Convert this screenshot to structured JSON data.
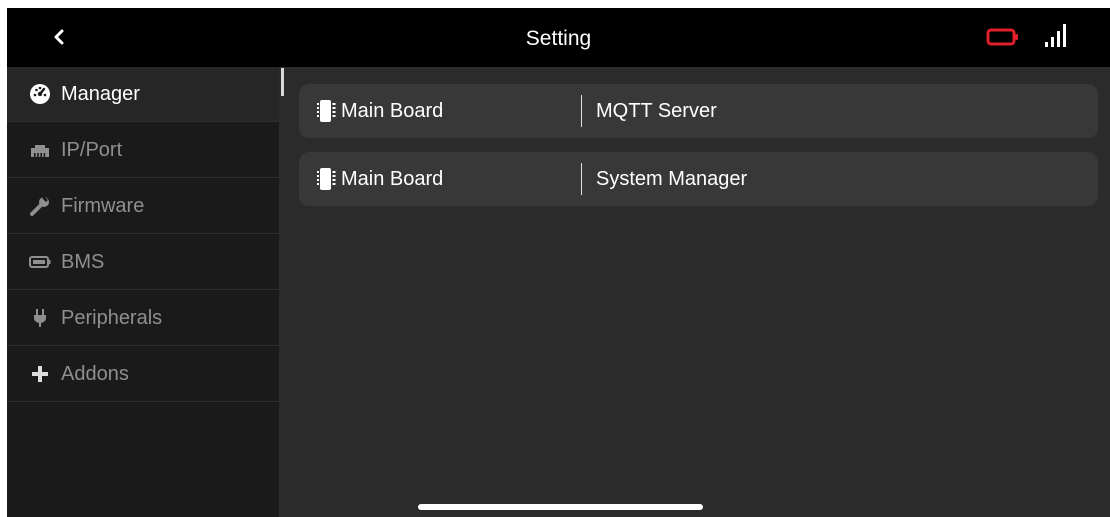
{
  "header": {
    "title": "Setting",
    "back_icon": "chevron-left-icon",
    "battery_icon": "battery-icon",
    "signal_icon": "signal-bars-icon",
    "battery_color": "#e0202a"
  },
  "sidebar": {
    "items": [
      {
        "label": "Manager",
        "icon": "dashboard-gauge-icon",
        "active": true
      },
      {
        "label": "IP/Port",
        "icon": "ethernet-port-icon",
        "active": false
      },
      {
        "label": "Firmware",
        "icon": "wrench-icon",
        "active": false
      },
      {
        "label": "BMS",
        "icon": "battery-icon",
        "active": false
      },
      {
        "label": "Peripherals",
        "icon": "plug-icon",
        "active": false
      },
      {
        "label": "Addons",
        "icon": "plus-icon",
        "active": false
      }
    ]
  },
  "rows": [
    {
      "board": "Main Board",
      "name": "MQTT Server",
      "icon": "chip-icon"
    },
    {
      "board": "Main Board",
      "name": "System Manager",
      "icon": "chip-icon"
    }
  ]
}
